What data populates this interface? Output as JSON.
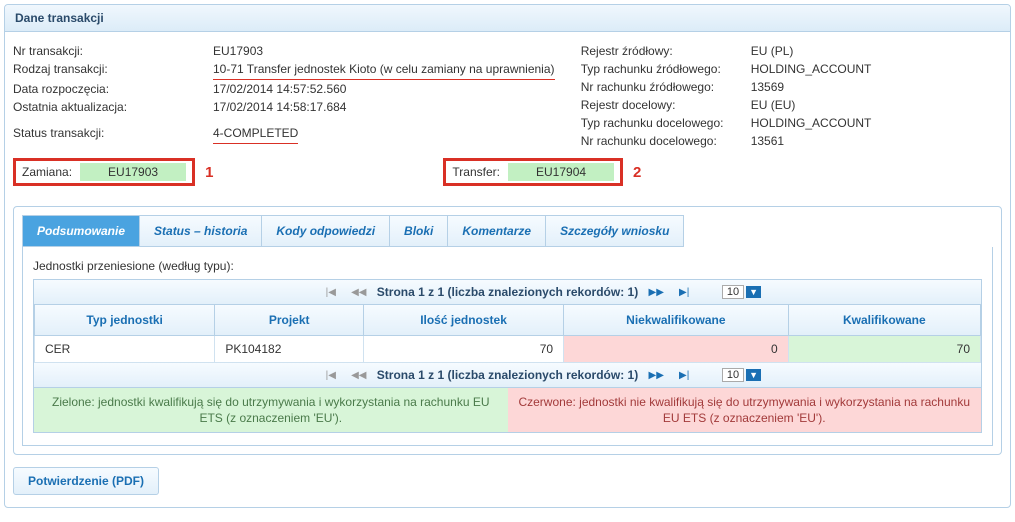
{
  "panel_title": "Dane transakcji",
  "left": {
    "tx_nr_label": "Nr transakcji:",
    "tx_nr": "EU17903",
    "type_label": "Rodzaj transakcji:",
    "type": "10-71 Transfer jednostek Kioto (w celu zamiany na uprawnienia)",
    "start_label": "Data rozpoczęcia:",
    "start": "17/02/2014 14:57:52.560",
    "update_label": "Ostatnia aktualizacja:",
    "update": "17/02/2014 14:58:17.684",
    "status_label": "Status transakcji:",
    "status": "4-COMPLETED"
  },
  "right": {
    "src_reg_label": "Rejestr źródłowy:",
    "src_reg": "EU (PL)",
    "src_type_label": "Typ rachunku źródłowego:",
    "src_type": "HOLDING_ACCOUNT",
    "src_nr_label": "Nr rachunku źródłowego:",
    "src_nr": "13569",
    "dst_reg_label": "Rejestr docelowy:",
    "dst_reg": "EU (EU)",
    "dst_type_label": "Typ rachunku docelowego:",
    "dst_type": "HOLDING_ACCOUNT",
    "dst_nr_label": "Nr rachunku docelowego:",
    "dst_nr": "13561"
  },
  "links": {
    "zamiana_label": "Zamiana:",
    "zamiana_val": "EU17903",
    "zamiana_num": "1",
    "transfer_label": "Transfer:",
    "transfer_val": "EU17904",
    "transfer_num": "2"
  },
  "tabs": {
    "t0": "Podsumowanie",
    "t1": "Status – historia",
    "t2": "Kody odpowiedzi",
    "t3": "Bloki",
    "t4": "Komentarze",
    "t5": "Szczegóły wniosku"
  },
  "list_title": "Jednostki przeniesione (według typu):",
  "pager": {
    "label": "Strona 1 z 1 (liczba znalezionych rekordów: 1)",
    "page_size": "10"
  },
  "columns": {
    "c0": "Typ jednostki",
    "c1": "Projekt",
    "c2": "Ilość jednostek",
    "c3": "Niekwalifikowane",
    "c4": "Kwalifikowane"
  },
  "row": {
    "type": "CER",
    "project": "PK104182",
    "qty": "70",
    "nq": "0",
    "q": "70"
  },
  "legend": {
    "green": "Zielone: jednostki kwalifikują się do utrzymywania i wykorzystania na rachunku EU ETS (z oznaczeniem 'EU').",
    "red": "Czerwone: jednostki nie kwalifikują się do utrzymywania i wykorzystania na rachunku EU ETS (z oznaczeniem 'EU')."
  },
  "pdf_label": "Potwierdzenie (PDF)"
}
